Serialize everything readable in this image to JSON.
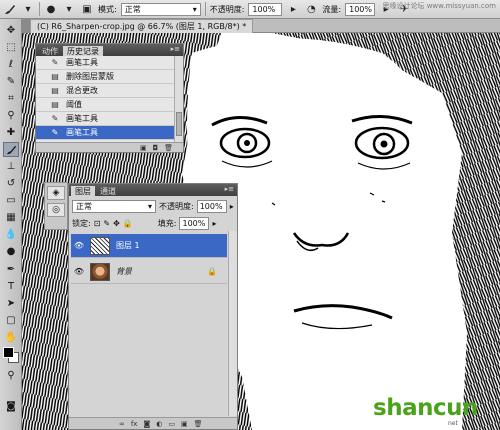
{
  "options_bar": {
    "mode_label": "模式:",
    "mode_value": "正常",
    "opacity_label": "不透明度:",
    "opacity_value": "100%",
    "flow_label": "流量:",
    "flow_value": "100%",
    "tool_icon": "brush-icon",
    "site_watermark": "思缘设计论坛  www.missyuan.com"
  },
  "document_tab": {
    "title": "(C) R6_Sharpen-crop.jpg @ 66.7% (图层 1, RGB/8*) *"
  },
  "history_panel": {
    "tabs": [
      "动作",
      "历史记录"
    ],
    "active_tab": 1,
    "items": [
      {
        "label": "画笔工具",
        "icon": "brush-icon"
      },
      {
        "label": "删除图层蒙版",
        "icon": "document-icon"
      },
      {
        "label": "混合更改",
        "icon": "document-icon"
      },
      {
        "label": "阈值",
        "icon": "document-icon"
      },
      {
        "label": "画笔工具",
        "icon": "brush-icon"
      },
      {
        "label": "画笔工具",
        "icon": "brush-icon"
      }
    ],
    "selected_index": 5
  },
  "layers_panel": {
    "tabs": [
      "图层",
      "通道"
    ],
    "active_tab": 0,
    "blend_mode": "正常",
    "opacity_label": "不透明度:",
    "opacity_value": "100%",
    "lock_label": "锁定:",
    "fill_label": "填充:",
    "fill_value": "100%",
    "layers": [
      {
        "name": "图层 1",
        "selected": true,
        "visible": true,
        "locked": false
      },
      {
        "name": "背景",
        "selected": false,
        "visible": true,
        "locked": true
      }
    ]
  },
  "logo": {
    "text": "shancun",
    "sub": "net"
  },
  "colors": {
    "selection": "#3a68c4",
    "logo_green": "#4aa31a",
    "panel_bg": "#d4d4d4"
  }
}
